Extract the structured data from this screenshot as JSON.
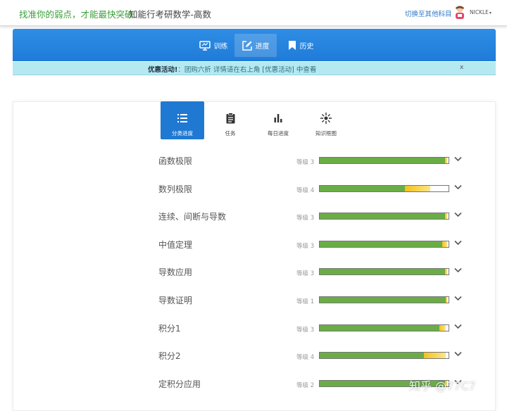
{
  "header": {
    "slogan": "找准你的弱点，才能最快突破",
    "course": "知能行考研数学-高数",
    "switch_label": "切换至其他科目",
    "username": "NICKLE",
    "caret": "▾"
  },
  "nav": {
    "items": [
      {
        "label": "训练",
        "icon": "monitor-icon"
      },
      {
        "label": "进度",
        "icon": "edit-icon",
        "active": true
      },
      {
        "label": "历史",
        "icon": "bookmark-icon"
      }
    ]
  },
  "promo": {
    "title": "优惠活动!",
    "text": "：团购六折 详情请在右上角 [优惠活动] 中查看",
    "close": "x"
  },
  "subtabs": [
    {
      "label": "分类进度",
      "icon": "list-icon",
      "active": true
    },
    {
      "label": "任务",
      "icon": "clipboard-icon"
    },
    {
      "label": "每日进度",
      "icon": "bar-chart-icon"
    },
    {
      "label": "知识框图",
      "icon": "network-icon"
    }
  ],
  "topics": [
    {
      "name": "函数极限",
      "level": "等级 3",
      "green": 0.97,
      "yellow": 0.02
    },
    {
      "name": "数列极限",
      "level": "等级 4",
      "green": 0.66,
      "yellow": 0.2
    },
    {
      "name": "连续、间断与导数",
      "level": "等级 3",
      "green": 0.97,
      "yellow": 0.02
    },
    {
      "name": "中值定理",
      "level": "等级 3",
      "green": 0.95,
      "yellow": 0.04
    },
    {
      "name": "导数应用",
      "level": "等级 3",
      "green": 0.97,
      "yellow": 0.02
    },
    {
      "name": "导数证明",
      "level": "等级 1",
      "green": 0.98,
      "yellow": 0.01
    },
    {
      "name": "积分1",
      "level": "等级 3",
      "green": 0.93,
      "yellow": 0.05
    },
    {
      "name": "积分2",
      "level": "等级 4",
      "green": 0.81,
      "yellow": 0.17
    },
    {
      "name": "定积分应用",
      "level": "等级 2",
      "green": 0.97,
      "yellow": 0.02
    }
  ],
  "watermark": "知乎 @77C7",
  "colors": {
    "brand": "#1f79d3",
    "progress_green": "#6aad47",
    "progress_yellow": "#f4c21a",
    "promo_bg": "#b4e9f2"
  }
}
